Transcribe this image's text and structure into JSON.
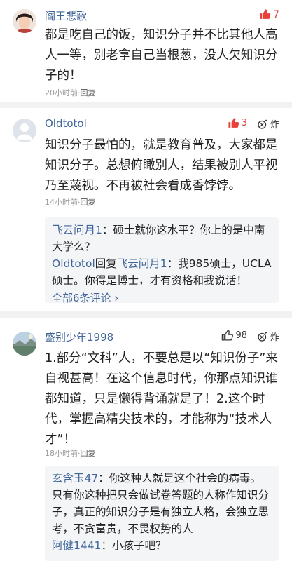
{
  "comments": [
    {
      "username": "阎王悲歌",
      "likes": "7",
      "text": "都是吃自己的饭，知识分子并不比其他人高人一等，别老拿自己当根葱，没人欠知识分子的！",
      "time": "20小时前",
      "reply_label": "回复"
    },
    {
      "username": "Oldtotol",
      "likes": "3",
      "bomb_label": "炸",
      "text": "知识分子最怕的，就是教育普及，大家都是知识分子。总想俯瞰别人，结果被别人平视乃至蔑视。不再被社会看成香饽饽。",
      "time": "14小时前",
      "reply_label": "回复",
      "replies": [
        {
          "name": "飞云问月1",
          "sep": "：",
          "text": "硕士就你这水平？你上的是中南大学么？"
        },
        {
          "name": "Oldtotol",
          "mid": "回复",
          "target": "飞云问月1",
          "sep": "：",
          "text": "我985硕士，UCLA硕士。你得是博士，才有资格和我说话！"
        }
      ],
      "more_label": "全部6条评论 ›"
    },
    {
      "username": "盛别少年1998",
      "likes": "98",
      "bomb_label": "炸",
      "text": "1.部分“文科”人，不要总是以“知识份子”来自视甚高！在这个信息时代，你那点知识谁都知道，只是懒得背诵就是了！2.这个时代，掌握高精尖技术的，才能称为“技术人才”！",
      "time": "18小时前",
      "reply_label": "回复",
      "replies": [
        {
          "name": "玄含玉47",
          "sep": "：",
          "text": "你这种人就是这个社会的病毒。只有你这种把只会做试卷答题的人称作知识分子，真正的知识分子是有独立人格，会独立思考，不贪富贵，不畏权势的人"
        },
        {
          "name": "阿健1441",
          "sep": "：",
          "text": "小孩子吧？"
        }
      ]
    }
  ],
  "colors": {
    "username": "#406599",
    "like_active": "#e8413a",
    "meta": "#999999",
    "reply_bg": "#f4f5f7"
  }
}
